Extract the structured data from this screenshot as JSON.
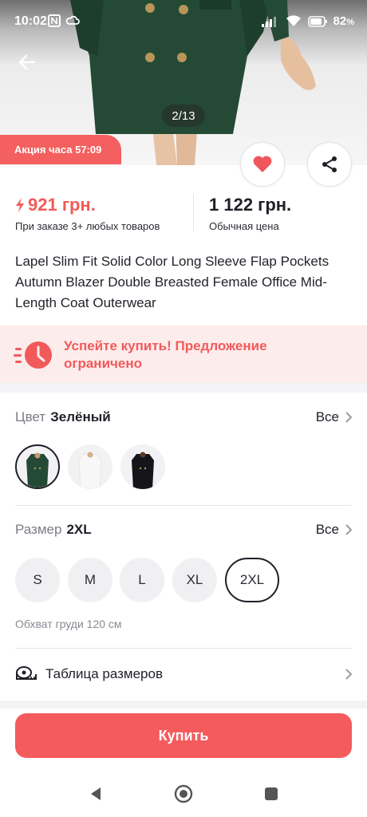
{
  "status_bar": {
    "time": "10:02",
    "battery": "82"
  },
  "gallery": {
    "counter": "2/13",
    "promo": "Акция часа 57:09"
  },
  "pricing": {
    "sale_amount": "921 грн.",
    "sale_note": "При заказе 3+ любых товаров",
    "regular_amount": "1 122 грн.",
    "regular_note": "Обычная цена"
  },
  "product": {
    "title": "Lapel Slim Fit Solid Color Long Sleeve Flap Pockets Autumn Blazer Double Breasted Female Office Mid-Length Coat Outerwear"
  },
  "urgency": {
    "text": "Успейте купить! Предложение ограничено"
  },
  "color": {
    "label": "Цвет",
    "selected": "Зелёный",
    "all_label": "Все",
    "swatches": [
      "green",
      "white",
      "black"
    ]
  },
  "size": {
    "label": "Размер",
    "selected": "2XL",
    "all_label": "Все",
    "options": [
      "S",
      "M",
      "L",
      "XL",
      "2XL"
    ],
    "measure_note": "Обхват груди 120 см"
  },
  "size_table": {
    "label": "Таблица размеров"
  },
  "buy": {
    "label": "Купить"
  },
  "colors": {
    "accent": "#f45b5d",
    "sale_text": "#f25a5a",
    "urgency_bg": "#fdecec"
  },
  "icons": [
    "back-arrow-icon",
    "heart-icon",
    "share-icon",
    "lightning-icon",
    "clock-icon",
    "chevron-right-icon",
    "tape-measure-icon",
    "nav-back-icon",
    "nav-home-icon",
    "nav-recents-icon"
  ]
}
